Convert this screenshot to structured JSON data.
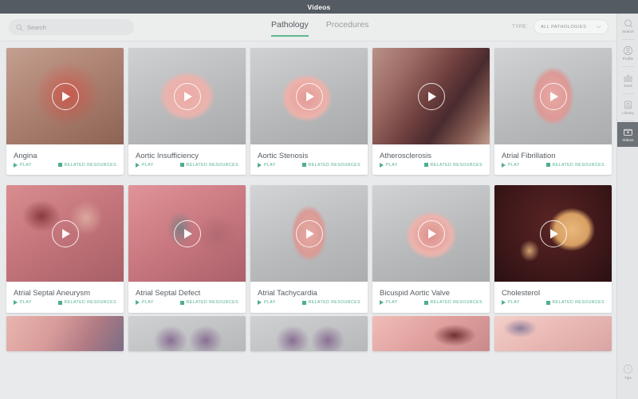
{
  "window": {
    "title": "Videos"
  },
  "toolbar": {
    "search": {
      "placeholder": "Search",
      "value": "",
      "icon": "search-icon"
    },
    "tabs": [
      {
        "label": "Pathology",
        "active": true
      },
      {
        "label": "Procedures",
        "active": false
      }
    ],
    "type_filter": {
      "label": "TYPE:",
      "selected": "ALL PATHOLOGIES",
      "icon": "chevron-down-icon"
    },
    "accent_color": "#5cb88f"
  },
  "card_actions": {
    "play_label": "PLAY",
    "related_label": "RELATED RESOURCES",
    "play_icon": "play-triangle-icon",
    "related_icon": "square-icon",
    "color": "#4fae8b"
  },
  "videos": [
    {
      "title": "Angina",
      "thumb": "angina"
    },
    {
      "title": "Aortic Insufficiency",
      "thumb": "aortic-insufficiency"
    },
    {
      "title": "Aortic Stenosis",
      "thumb": "aortic-stenosis"
    },
    {
      "title": "Atherosclerosis",
      "thumb": "atherosclerosis"
    },
    {
      "title": "Atrial Fibrillation",
      "thumb": "atrial-fibrillation"
    },
    {
      "title": "Atrial Septal Aneurysm",
      "thumb": "atrial-septal-aneurysm"
    },
    {
      "title": "Atrial Septal Defect",
      "thumb": "atrial-septal-defect"
    },
    {
      "title": "Atrial Tachycardia",
      "thumb": "atrial-tachycardia"
    },
    {
      "title": "Bicuspid Aortic Valve",
      "thumb": "bicuspid-aortic-valve"
    },
    {
      "title": "Cholesterol",
      "thumb": "cholesterol"
    }
  ],
  "partial_row": [
    {
      "thumb": "lung-closeup"
    },
    {
      "thumb": "lungs-purple"
    },
    {
      "thumb": "lungs-purple-2"
    },
    {
      "thumb": "heart-chamber"
    },
    {
      "thumb": "heart-vessel"
    }
  ],
  "sidebar": {
    "items": [
      {
        "label": "Search",
        "icon": "search-icon",
        "active": false
      },
      {
        "label": "Profile",
        "icon": "profile-icon",
        "active": false
      },
      {
        "label": "Tools",
        "icon": "tools-icon",
        "active": false
      },
      {
        "label": "Library",
        "icon": "library-icon",
        "active": false
      },
      {
        "label": "Videos",
        "icon": "video-icon",
        "active": true
      }
    ],
    "tips": {
      "label": "Tips",
      "icon": "question-circle-icon"
    }
  }
}
